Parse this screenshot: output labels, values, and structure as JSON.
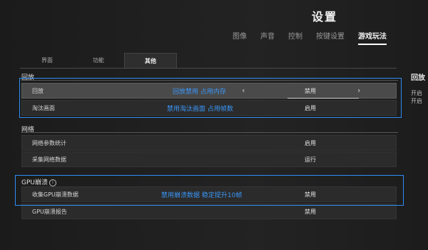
{
  "header": {
    "title": "设置",
    "tabs": [
      {
        "label": "图像",
        "active": false
      },
      {
        "label": "声音",
        "active": false
      },
      {
        "label": "控制",
        "active": false
      },
      {
        "label": "按键设置",
        "active": false
      },
      {
        "label": "游戏玩法",
        "active": true
      }
    ]
  },
  "subtabs": [
    {
      "label": "界面",
      "active": false
    },
    {
      "label": "功能",
      "active": false
    },
    {
      "label": "其他",
      "active": true
    }
  ],
  "sections": {
    "replay": {
      "title": "回放",
      "rows": [
        {
          "label": "回放",
          "value": "禁用"
        },
        {
          "label": "淘汰画面",
          "value": "启用"
        }
      ]
    },
    "network": {
      "title": "网络",
      "rows": [
        {
          "label": "网络参数统计",
          "value": "启用"
        },
        {
          "label": "采集网络数据",
          "value": "运行"
        }
      ]
    },
    "gpu": {
      "title": "GPU崩溃",
      "info_icon": "info-icon",
      "rows": [
        {
          "label": "收集GPU崩溃数据",
          "value": "禁用"
        },
        {
          "label": "GPU崩溃报告",
          "value": "禁用"
        }
      ]
    }
  },
  "annotations": {
    "a1": "回放禁用 占用内存",
    "a2": "禁用淘汰画面 占用帧数",
    "a3": "禁用崩溃数据 稳定提升10帧"
  },
  "right_panel": {
    "title": "回放",
    "line1": "开启",
    "line2": "开启"
  },
  "colors": {
    "annotation": "#2f8df5",
    "background": "#1a1a1a",
    "row_highlight": "#4a4a4a"
  }
}
